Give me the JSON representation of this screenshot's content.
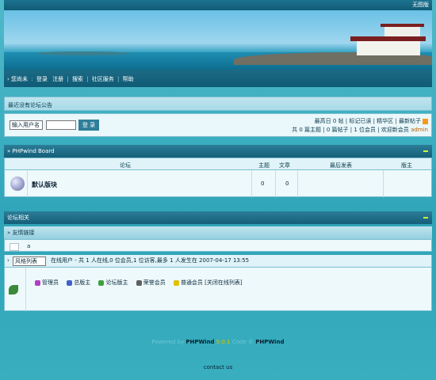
{
  "topbar": {
    "no_image_label": "无图版"
  },
  "nav": {
    "items": [
      "您尚未",
      "登录",
      "注册",
      "搜索",
      "社区服务",
      "帮助"
    ]
  },
  "announcement": {
    "text": "最近没有论坛公告"
  },
  "login": {
    "username_placeholder": "输入用户名",
    "login_button": "登 录",
    "stats_line1": "最高日 0 帖 | 标记已读 | 精华区 | 最新帖子",
    "stats_line2_prefix": "共 0 篇主题 | 0 篇帖子 | 1 位会员 | 欢迎新会员",
    "new_member": "admin"
  },
  "board": {
    "title": "» PHPwind Board",
    "columns": [
      "论坛",
      "主题",
      "文章",
      "最后发表",
      "版主"
    ],
    "rows": [
      {
        "name": "默认版块",
        "topics": "0",
        "posts": "0",
        "last_post": "",
        "moderator": ""
      }
    ]
  },
  "related": {
    "title": "论坛相关",
    "links_title": "» 友情链接",
    "link_value": "a",
    "online_select": "风格列表",
    "online_text": "在线用户 - 共 1 人在线,0 位会员,1 位访客,最多 1 人发生在 2007-04-17 13:55",
    "legend": [
      "管理员",
      "总版主",
      "论坛版主",
      "荣誉会员",
      "普通会员 [关闭在线列表]"
    ]
  },
  "footer": {
    "powered": "PHPWind",
    "version": "5.0.1",
    "brand": "PHPWind",
    "contact": "contact us"
  },
  "colors": {
    "bar": "#155f79",
    "accent_new_member": "#c06000",
    "version": "#d6c400"
  }
}
